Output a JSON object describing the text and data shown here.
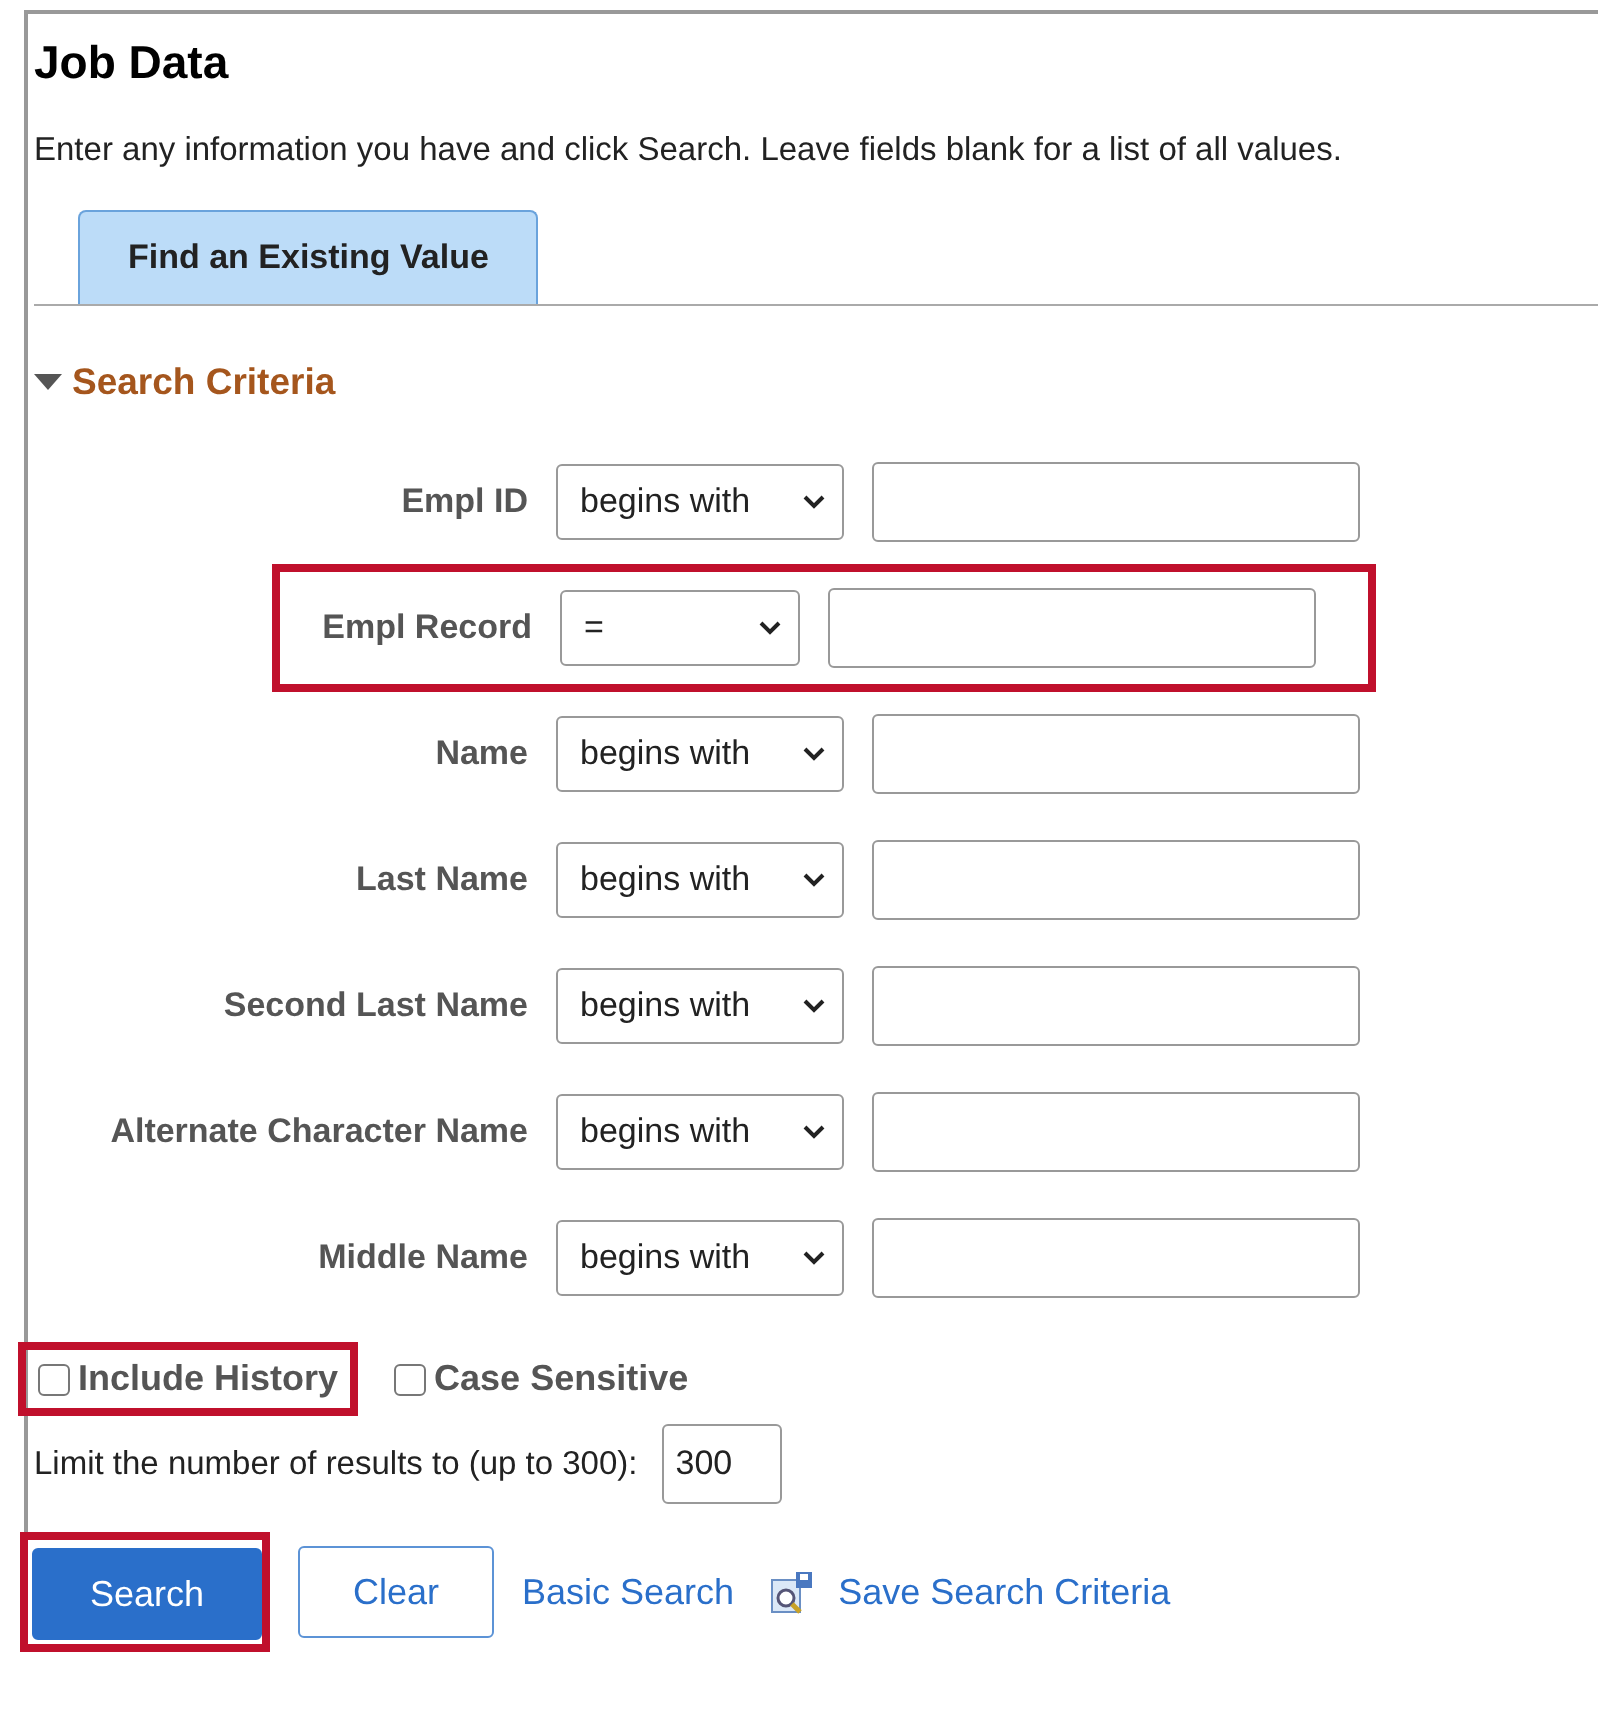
{
  "page": {
    "title": "Job Data",
    "instructions": "Enter any information you have and click Search. Leave fields blank for a list of all values."
  },
  "tabs": [
    {
      "label": "Find an Existing Value",
      "selected": true
    }
  ],
  "section": {
    "title": "Search Criteria",
    "expanded": true
  },
  "fields": [
    {
      "label": "Empl ID",
      "kind": "text",
      "operator": "begins with",
      "highlighted": false
    },
    {
      "label": "Empl Record",
      "kind": "number",
      "operator": "=",
      "highlighted": true
    },
    {
      "label": "Name",
      "kind": "text",
      "operator": "begins with",
      "highlighted": false
    },
    {
      "label": "Last Name",
      "kind": "text",
      "operator": "begins with",
      "highlighted": false
    },
    {
      "label": "Second Last Name",
      "kind": "text",
      "operator": "begins with",
      "highlighted": false
    },
    {
      "label": "Alternate Character Name",
      "kind": "text",
      "operator": "begins with",
      "highlighted": false
    },
    {
      "label": "Middle Name",
      "kind": "text",
      "operator": "begins with",
      "highlighted": false
    }
  ],
  "options": [
    {
      "label": "Include History",
      "checked": false,
      "highlighted": true
    },
    {
      "label": "Case Sensitive",
      "checked": false,
      "highlighted": false
    }
  ],
  "limit": {
    "label": "Limit the number of results to (up to 300):",
    "value": "300"
  },
  "actions": [
    {
      "kind": "primary",
      "label": "Search",
      "highlighted": true
    },
    {
      "kind": "secondary",
      "label": "Clear",
      "highlighted": false
    },
    {
      "kind": "link",
      "label": "Basic Search",
      "highlighted": false
    },
    {
      "kind": "icon-link",
      "label": "Save Search Criteria",
      "highlighted": false
    }
  ]
}
